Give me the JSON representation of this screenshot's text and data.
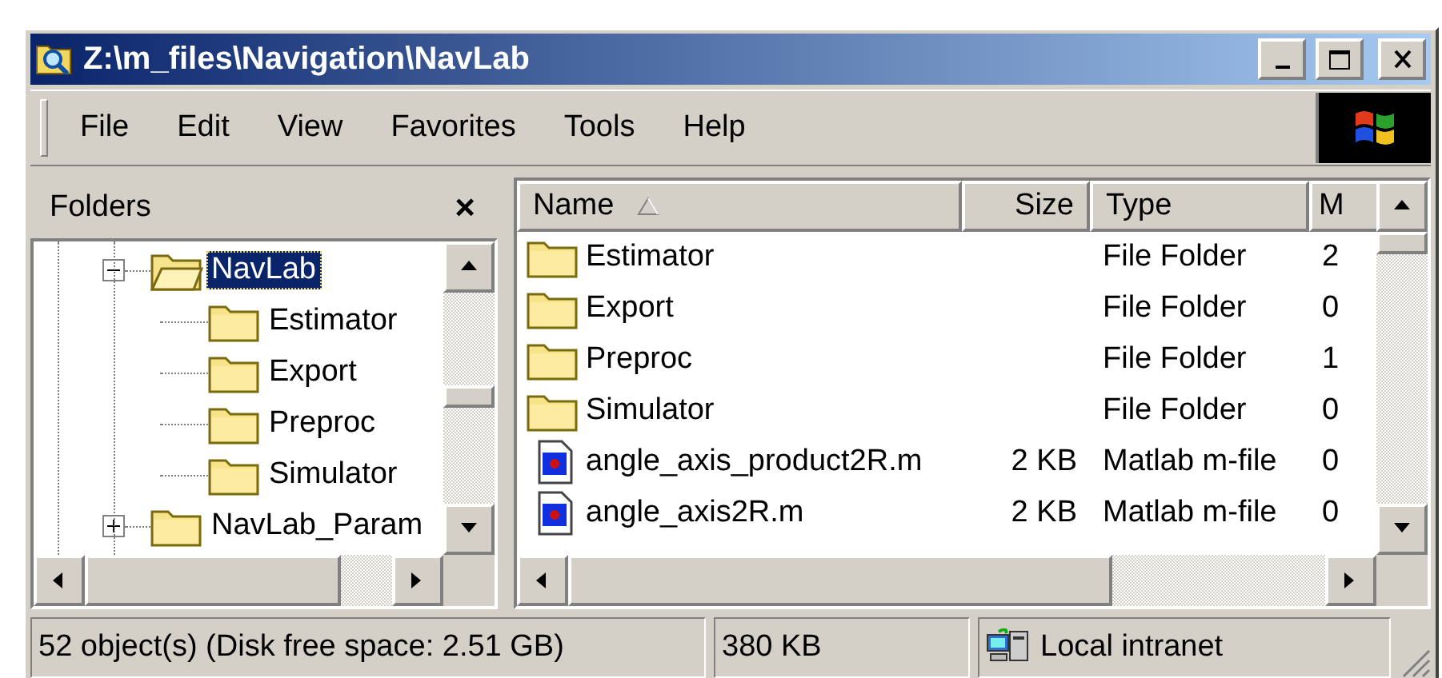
{
  "window": {
    "title": "Z:\\m_files\\Navigation\\NavLab"
  },
  "menu": [
    {
      "label": "File"
    },
    {
      "label": "Edit"
    },
    {
      "label": "View"
    },
    {
      "label": "Favorites"
    },
    {
      "label": "Tools"
    },
    {
      "label": "Help"
    }
  ],
  "folders_pane": {
    "title": "Folders",
    "close_glyph": "×",
    "tree": [
      {
        "label": "NavLab",
        "expanded": true,
        "selected": true,
        "children": [
          {
            "label": "Estimator",
            "selected": false
          },
          {
            "label": "Export",
            "selected": false
          },
          {
            "label": "Preproc",
            "selected": false
          },
          {
            "label": "Simulator",
            "selected": false
          }
        ]
      },
      {
        "label": "NavLab_Param",
        "expanded": false,
        "selected": false
      }
    ]
  },
  "file_list": {
    "columns": [
      {
        "label": "Name",
        "sorted": true
      },
      {
        "label": "Size",
        "sorted": false
      },
      {
        "label": "Type",
        "sorted": false
      },
      {
        "label": "M",
        "sorted": false
      }
    ],
    "rows": [
      {
        "kind": "folder",
        "name": "Estimator",
        "type": "File Folder",
        "column_4": "2"
      },
      {
        "kind": "folder",
        "name": "Export",
        "type": "File Folder",
        "column_4": "0"
      },
      {
        "kind": "folder",
        "name": "Preproc",
        "type": "File Folder",
        "column_4": "1"
      },
      {
        "kind": "folder",
        "name": "Simulator",
        "type": "File Folder",
        "column_4": "0"
      },
      {
        "kind": "mfile",
        "name": "angle_axis_product2R.m",
        "size": "2 KB",
        "type": "Matlab m-file",
        "column_4": "0"
      },
      {
        "kind": "mfile",
        "name": "angle_axis2R.m",
        "size": "2 KB",
        "type": "Matlab m-file",
        "column_4": "0"
      }
    ]
  },
  "status_bar": {
    "objects": "52 object(s) (Disk free space: 2.51 GB)",
    "size": "380 KB",
    "zone": "Local intranet"
  }
}
